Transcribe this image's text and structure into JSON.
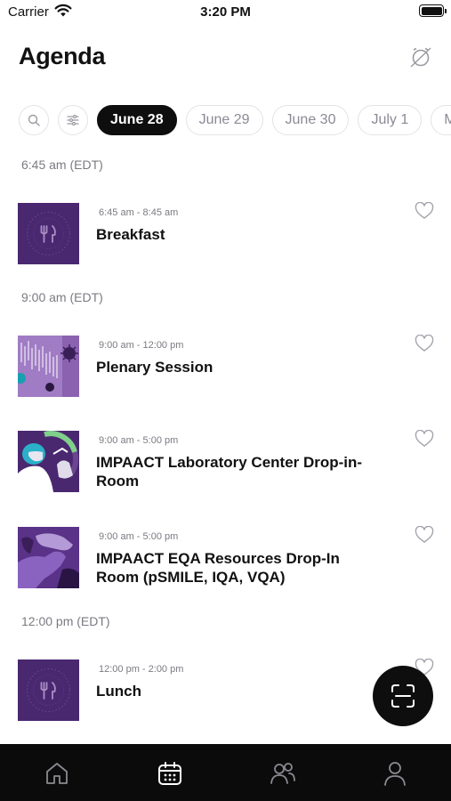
{
  "status_bar": {
    "carrier": "Carrier",
    "time": "3:20 PM"
  },
  "header": {
    "title": "Agenda"
  },
  "date_chips": [
    "June 28",
    "June 29",
    "June 30",
    "July 1",
    "M"
  ],
  "selected_date": "June 28",
  "groups": [
    {
      "time": "6:45 am (EDT)"
    },
    {
      "time": "9:00 am (EDT)"
    },
    {
      "time": "12:00 pm (EDT)"
    }
  ],
  "sessions": [
    {
      "time": "6:45 am - 8:45 am",
      "title": "Breakfast",
      "icon": "fork-knife-icon"
    },
    {
      "time": "9:00 am - 12:00 pm",
      "title": "Plenary Session",
      "icon": "virus-image"
    },
    {
      "time": "9:00 am - 5:00 pm",
      "title": "IMPAACT Laboratory Center Drop-in-Room",
      "icon": "lab-worker-image"
    },
    {
      "time": "9:00 am - 5:00 pm",
      "title": "IMPAACT EQA Resources Drop-In Room (pSMILE, IQA, VQA)",
      "icon": "gloved-hands-image"
    },
    {
      "time": "12:00 pm - 2:00 pm",
      "title": "Lunch",
      "icon": "fork-knife-icon"
    }
  ],
  "colors": {
    "accent": "#0e0e0e",
    "thumb_purple": "#4a2870",
    "muted_text": "#7a7a82",
    "nav_bg": "#0b0b0b"
  },
  "bottom_nav": [
    "home-icon",
    "calendar-icon",
    "people-icon",
    "profile-icon"
  ],
  "active_nav": "calendar-icon"
}
